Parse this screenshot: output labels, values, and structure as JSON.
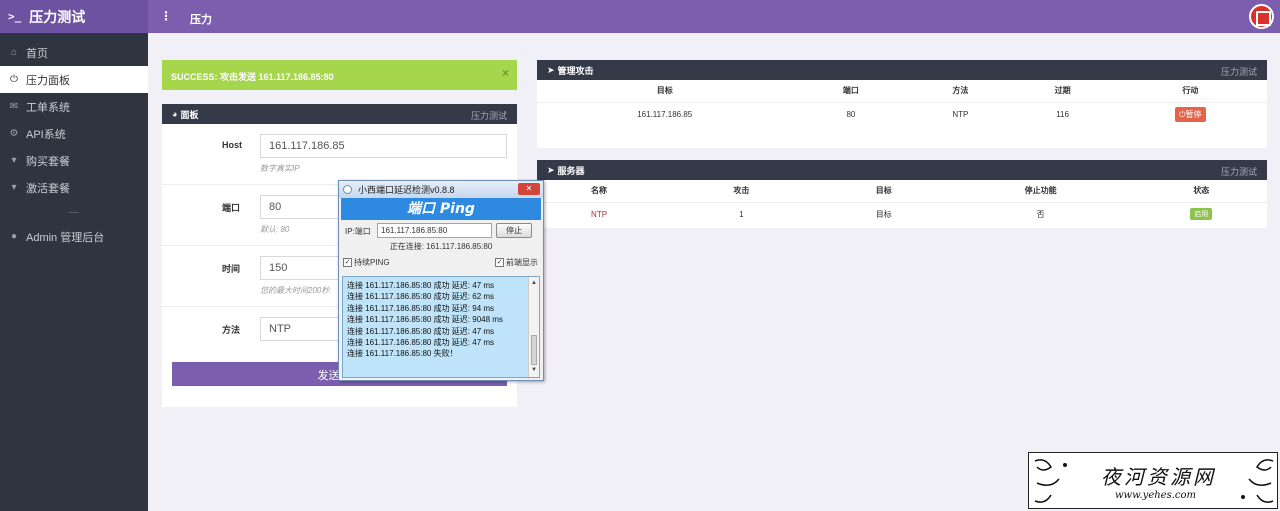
{
  "app": {
    "brand": "压力测试",
    "breadcrumb": "压力"
  },
  "sidebar": {
    "items": [
      {
        "icon": "home-icon",
        "label": "首页",
        "active": false
      },
      {
        "icon": "power-icon",
        "label": "压力面板",
        "active": true
      },
      {
        "icon": "ticket-icon",
        "label": "工单系统",
        "active": false
      },
      {
        "icon": "cogs-icon",
        "label": "API系统",
        "active": false
      },
      {
        "icon": "cart-icon",
        "label": "购买套餐",
        "active": false
      },
      {
        "icon": "cart-icon",
        "label": "激活套餐",
        "active": false
      },
      {
        "icon": "admin-icon",
        "label": "Admin 管理后台",
        "active": false
      }
    ]
  },
  "alert": {
    "text": "SUCCESS: 攻击发送 161.117.186.85:80"
  },
  "panel": {
    "title": "面板",
    "subtitle": "压力测试",
    "host": {
      "label": "Host",
      "value": "161.117.186.85",
      "help": "数字真实IP"
    },
    "port": {
      "label": "端口",
      "value": "80",
      "help": "默认: 80"
    },
    "time": {
      "label": "时间",
      "value": "150",
      "help": "您的最大时间200秒"
    },
    "method": {
      "label": "方法",
      "value": "NTP"
    },
    "submit": "发送攻击"
  },
  "attacks": {
    "title": "管理攻击",
    "subtitle": "压力测试",
    "headers": [
      "目标",
      "端口",
      "方法",
      "过期",
      "行动"
    ],
    "rows": [
      {
        "target": "161.117.186.85",
        "port": "80",
        "method": "NTP",
        "expire": "116",
        "action": "暂停"
      }
    ]
  },
  "servers": {
    "title": "服务器",
    "subtitle": "压力测试",
    "headers": [
      "名称",
      "攻击",
      "目标",
      "停止功能",
      "状态"
    ],
    "rows": [
      {
        "name": "NTP",
        "attacks": "1",
        "target": "目标",
        "stop": "否",
        "status": "启用"
      }
    ]
  },
  "ping_window": {
    "title": "小西端口延迟检测v0.8.8",
    "banner": "端口 Ping",
    "ip_label": "IP:端口",
    "ip_value": "161.117.186.85:80",
    "stop_label": "停止",
    "status": "正在连接: 161.117.186.85:80",
    "check_continuous": "持续PING",
    "check_topmost": "前端显示",
    "log": [
      "连接 161.117.186.85:80 成功 延迟: 47 ms",
      "连接 161.117.186.85:80 成功 延迟: 62 ms",
      "连接 161.117.186.85:80 成功 延迟: 94 ms",
      "连接 161.117.186.85:80 成功 延迟: 9048 ms",
      "连接 161.117.186.85:80 成功 延迟: 47 ms",
      "连接 161.117.186.85:80 成功 延迟: 47 ms",
      "连接 161.117.186.85:80 失败！"
    ]
  },
  "watermark": {
    "cn": "夜河资源网",
    "en": "www.yehes.com"
  }
}
